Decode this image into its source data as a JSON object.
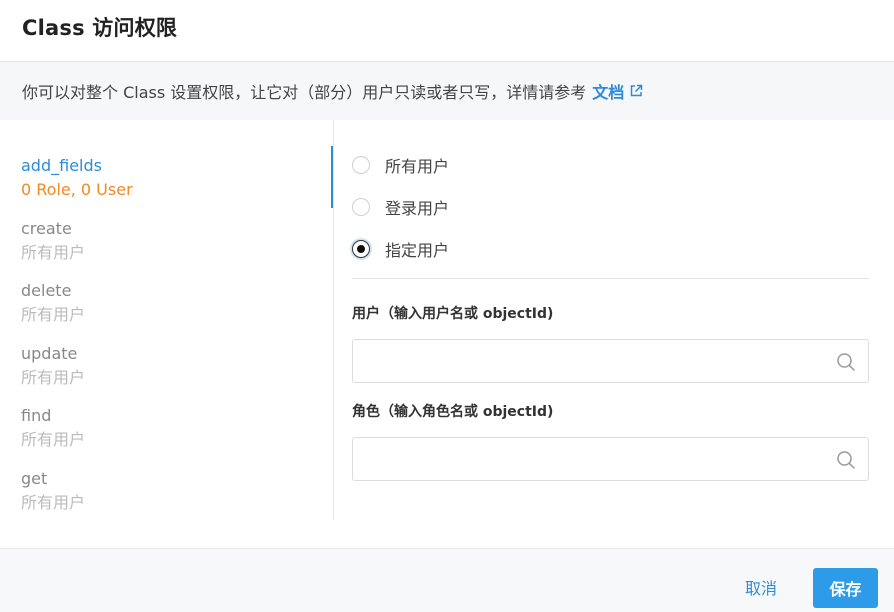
{
  "header": {
    "title": "Class 访问权限"
  },
  "notice": {
    "text": "你可以对整个 Class 设置权限，让它对（部分）用户只读或者只写，详情请参考",
    "link_label": "文档"
  },
  "permissions": [
    {
      "name": "add_fields",
      "sub": "0 Role, 0 User"
    },
    {
      "name": "create",
      "sub": "所有用户"
    },
    {
      "name": "delete",
      "sub": "所有用户"
    },
    {
      "name": "update",
      "sub": "所有用户"
    },
    {
      "name": "find",
      "sub": "所有用户"
    },
    {
      "name": "get",
      "sub": "所有用户"
    }
  ],
  "options": [
    {
      "label": "所有用户",
      "checked": false
    },
    {
      "label": "登录用户",
      "checked": false
    },
    {
      "label": "指定用户",
      "checked": true
    }
  ],
  "user_field": {
    "label": "用户（输入用户名或 objectId)",
    "value": "",
    "placeholder": ""
  },
  "role_field": {
    "label": "角色（输入角色名或 objectId)",
    "value": "",
    "placeholder": ""
  },
  "footer": {
    "cancel_label": "取消",
    "save_label": "保存"
  },
  "colors": {
    "accent": "#2e8bd8",
    "warning": "#f08a24",
    "primary_button": "#2e9be8"
  }
}
